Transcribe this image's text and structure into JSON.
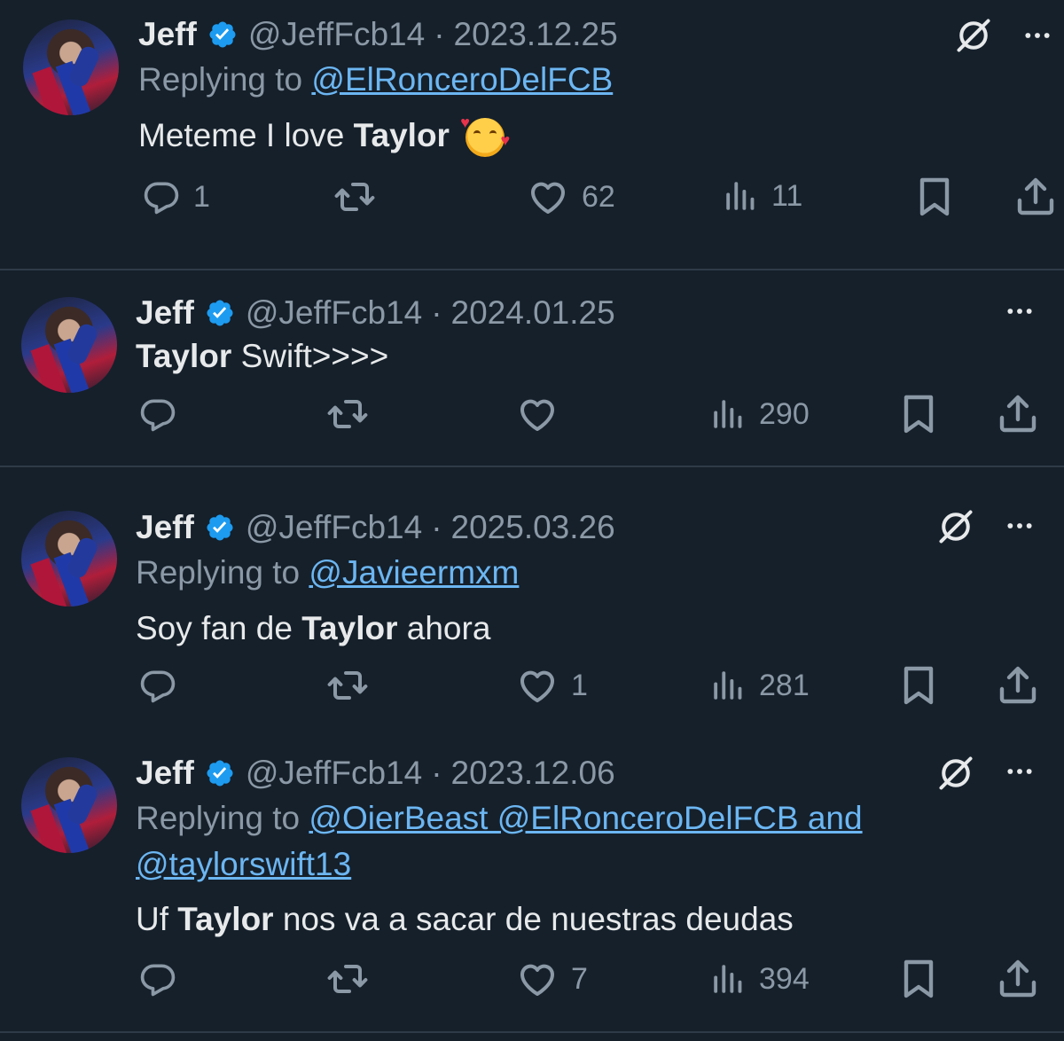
{
  "tweets": [
    {
      "name": "Jeff",
      "handle": "@JeffFcb14",
      "separator": "·",
      "date": "2023.12.25",
      "replying_prefix": "Replying to",
      "replying_to": "@ElRonceroDelFCB",
      "text_before": "Meteme I love",
      "text_bold": "Taylor",
      "text_after": "",
      "counts": {
        "reply": "1",
        "retweet": "",
        "like": "62",
        "views": "11"
      },
      "has_grok_icon": true
    },
    {
      "name": "Jeff",
      "handle": "@JeffFcb14",
      "separator": "·",
      "date": "2024.01.25",
      "text_bold": "Taylor",
      "text_after": "Swift>>>>",
      "counts": {
        "reply": "",
        "retweet": "",
        "like": "",
        "views": "290"
      },
      "has_grok_icon": false
    },
    {
      "name": "Jeff",
      "handle": "@JeffFcb14",
      "separator": "·",
      "date": "2025.03.26",
      "replying_prefix": "Replying to",
      "replying_to": "@Javieermxm",
      "text_before": "Soy fan de",
      "text_bold": "Taylor",
      "text_after": "ahora",
      "counts": {
        "reply": "",
        "retweet": "",
        "like": "1",
        "views": "281"
      },
      "has_grok_icon": true
    },
    {
      "name": "Jeff",
      "handle": "@JeffFcb14",
      "separator": "·",
      "date": "2023.12.06",
      "replying_prefix": "Replying to",
      "replying_to_line1": "@OierBeast @ElRonceroDelFCB and",
      "replying_to_line2": "@taylorswift13",
      "text_before": "Uf",
      "text_bold": "Taylor",
      "text_after": "nos va a sacar de nuestras deudas",
      "counts": {
        "reply": "",
        "retweet": "",
        "like": "7",
        "views": "394"
      },
      "has_grok_icon": true
    }
  ],
  "colors": {
    "background": "#15202b",
    "text": "#e7e9ea",
    "muted": "#8b98a5",
    "link": "#6cb6f2",
    "verified": "#1d9bf0"
  },
  "icons": [
    "verified-badge-icon",
    "grok-icon",
    "more-icon",
    "reply-icon",
    "retweet-icon",
    "like-icon",
    "views-icon",
    "bookmark-icon",
    "share-icon",
    "emoji-smiling-hearts-icon"
  ]
}
